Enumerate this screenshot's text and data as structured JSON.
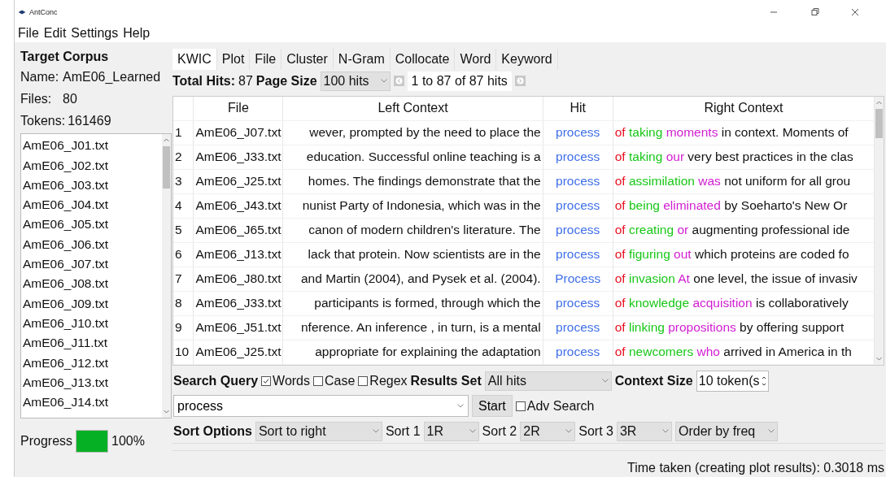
{
  "window": {
    "title": "AntConc"
  },
  "menu": [
    "File",
    "Edit",
    "Settings",
    "Help"
  ],
  "corpus": {
    "heading": "Target Corpus",
    "fields": [
      {
        "label": "Name:",
        "value": "AmE06_Learned"
      },
      {
        "label": "Files:",
        "value": "80"
      },
      {
        "label": "Tokens:",
        "value": "161469"
      }
    ],
    "files": [
      "AmE06_J01.txt",
      "AmE06_J02.txt",
      "AmE06_J03.txt",
      "AmE06_J04.txt",
      "AmE06_J05.txt",
      "AmE06_J06.txt",
      "AmE06_J07.txt",
      "AmE06_J08.txt",
      "AmE06_J09.txt",
      "AmE06_J10.txt",
      "AmE06_J11.txt",
      "AmE06_J12.txt",
      "AmE06_J13.txt",
      "AmE06_J14.txt"
    ],
    "progress": {
      "label": "Progress",
      "level": 1,
      "reading": "100%"
    }
  },
  "tabs": [
    {
      "label": "KWIC",
      "selected": true
    },
    {
      "label": "Plot",
      "selected": false
    },
    {
      "label": "File",
      "selected": false
    },
    {
      "label": "Cluster",
      "selected": false
    },
    {
      "label": "N-Gram",
      "selected": false
    },
    {
      "label": "Collocate",
      "selected": false
    },
    {
      "label": "Word",
      "selected": false
    },
    {
      "label": "Keyword",
      "selected": false
    }
  ],
  "hits_bar": {
    "total_label": "Total Hits:",
    "total": "87",
    "page_size_label": "Page Size",
    "page_size": "100 hits",
    "range": "1 to 87 of 87 hits"
  },
  "table": {
    "columns": [
      "File",
      "Left Context",
      "Hit",
      "Right Context"
    ],
    "rows": [
      {
        "number": "1",
        "file": "AmE06_J07.txt",
        "left": "wever, prompted by the need to place the",
        "hit": "process",
        "right": [
          "of",
          "taking",
          "moments",
          "in context. Moments of"
        ]
      },
      {
        "number": "2",
        "file": "AmE06_J33.txt",
        "left": "education. Successful online teaching is a",
        "hit": "process",
        "right": [
          "of",
          "taking",
          "our",
          "very best practices in the clas"
        ]
      },
      {
        "number": "3",
        "file": "AmE06_J25.txt",
        "left": "homes. The findings demonstrate that the",
        "hit": "process",
        "right": [
          "of",
          "assimilation",
          "was",
          "not uniform for all grou"
        ]
      },
      {
        "number": "4",
        "file": "AmE06_J43.txt",
        "left": "nunist Party of Indonesia, which was in the",
        "hit": "process",
        "right": [
          "of",
          "being",
          "eliminated",
          "by Soeharto's New Or"
        ]
      },
      {
        "number": "5",
        "file": "AmE06_J65.txt",
        "left": "canon of modern children's literature. The",
        "hit": "process",
        "right": [
          "of",
          "creating",
          "or",
          "augmenting professional ide"
        ]
      },
      {
        "number": "6",
        "file": "AmE06_J13.txt",
        "left": "lack that protein. Now scientists are in the",
        "hit": "process",
        "right": [
          "of",
          "figuring",
          "out",
          "which proteins are coded fo"
        ]
      },
      {
        "number": "7",
        "file": "AmE06_J80.txt",
        "left": "and Martin (2004), and Pysek et al. (2004).",
        "hit": "Process",
        "right": [
          "of",
          "invasion",
          "At",
          "one level, the issue of invasiv"
        ]
      },
      {
        "number": "8",
        "file": "AmE06_J33.txt",
        "left": "participants is formed, through which the",
        "hit": "process",
        "right": [
          "of",
          "knowledge",
          "acquisition",
          "is collaboratively"
        ]
      },
      {
        "number": "9",
        "file": "AmE06_J51.txt",
        "left": "nference. An inference , in turn, is a mental",
        "hit": "process",
        "right": [
          "of",
          "linking",
          "propositions",
          "by offering support"
        ]
      },
      {
        "number": "10",
        "file": "AmE06_J25.txt",
        "left": "appropriate for explaining the adaptation",
        "hit": "process",
        "right": [
          "of",
          "newcomers",
          "who",
          "arrived in America in th"
        ]
      }
    ]
  },
  "search": {
    "label": "Search Query",
    "options": [
      {
        "label": "Words",
        "checked": true
      },
      {
        "label": "Case",
        "checked": false
      },
      {
        "label": "Regex",
        "checked": false
      }
    ],
    "results_label": "Results Set",
    "results": "All hits",
    "context_label": "Context Size",
    "context": "10 token(s",
    "query": "process",
    "start": "Start",
    "adv": {
      "label": "Adv Search",
      "checked": false
    }
  },
  "sort": {
    "label": "Sort Options",
    "mode": "Sort to right",
    "levels": [
      {
        "label": "Sort 1",
        "value": "1R"
      },
      {
        "label": "Sort 2",
        "value": "2R"
      },
      {
        "label": "Sort 3",
        "value": "3R"
      }
    ],
    "order": "Order by freq"
  },
  "status_bar": "Time taken (creating plot results):  0.3018 ms"
}
